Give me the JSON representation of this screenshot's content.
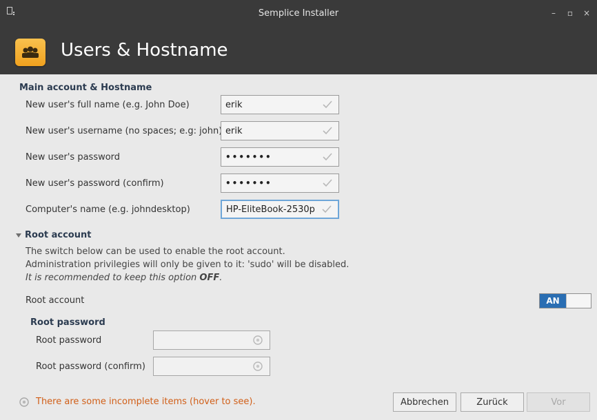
{
  "window": {
    "title": "Semplice Installer",
    "controls": {
      "minimize": "–",
      "maximize": "▫",
      "close": "×"
    }
  },
  "header": {
    "title": "Users & Hostname"
  },
  "main_account": {
    "title": "Main account & Hostname",
    "fields": [
      {
        "label": "New user's full name (e.g. John Doe)",
        "value": "erik"
      },
      {
        "label": "New user's username (no spaces; e.g: john)",
        "value": "erik"
      },
      {
        "label": "New user's password",
        "value": "•••••••"
      },
      {
        "label": "New user's password (confirm)",
        "value": "•••••••"
      },
      {
        "label": "Computer's name (e.g. johndesktop)",
        "value": "HP-EliteBook-2530p"
      }
    ]
  },
  "root_account": {
    "title": "Root account",
    "description": [
      "The switch below can be used to enable the root account.",
      "Administration privilegies will only be given to it: 'sudo' will be disabled."
    ],
    "recommend_prefix": "It is recommended to keep this option ",
    "recommend_strong": "OFF",
    "recommend_suffix": ".",
    "switch_label": "Root account",
    "switch_state": "AN"
  },
  "root_password": {
    "title": "Root password",
    "fields": [
      {
        "label": "Root password"
      },
      {
        "label": "Root password (confirm)"
      }
    ]
  },
  "status": {
    "message": "There are some incomplete items (hover to see)."
  },
  "buttons": {
    "cancel": "Abbrechen",
    "back": "Zurück",
    "next": "Vor"
  },
  "colors": {
    "accent": "#2a6eb3",
    "warning": "#d15f18",
    "header_bg": "#3a3a3a"
  }
}
